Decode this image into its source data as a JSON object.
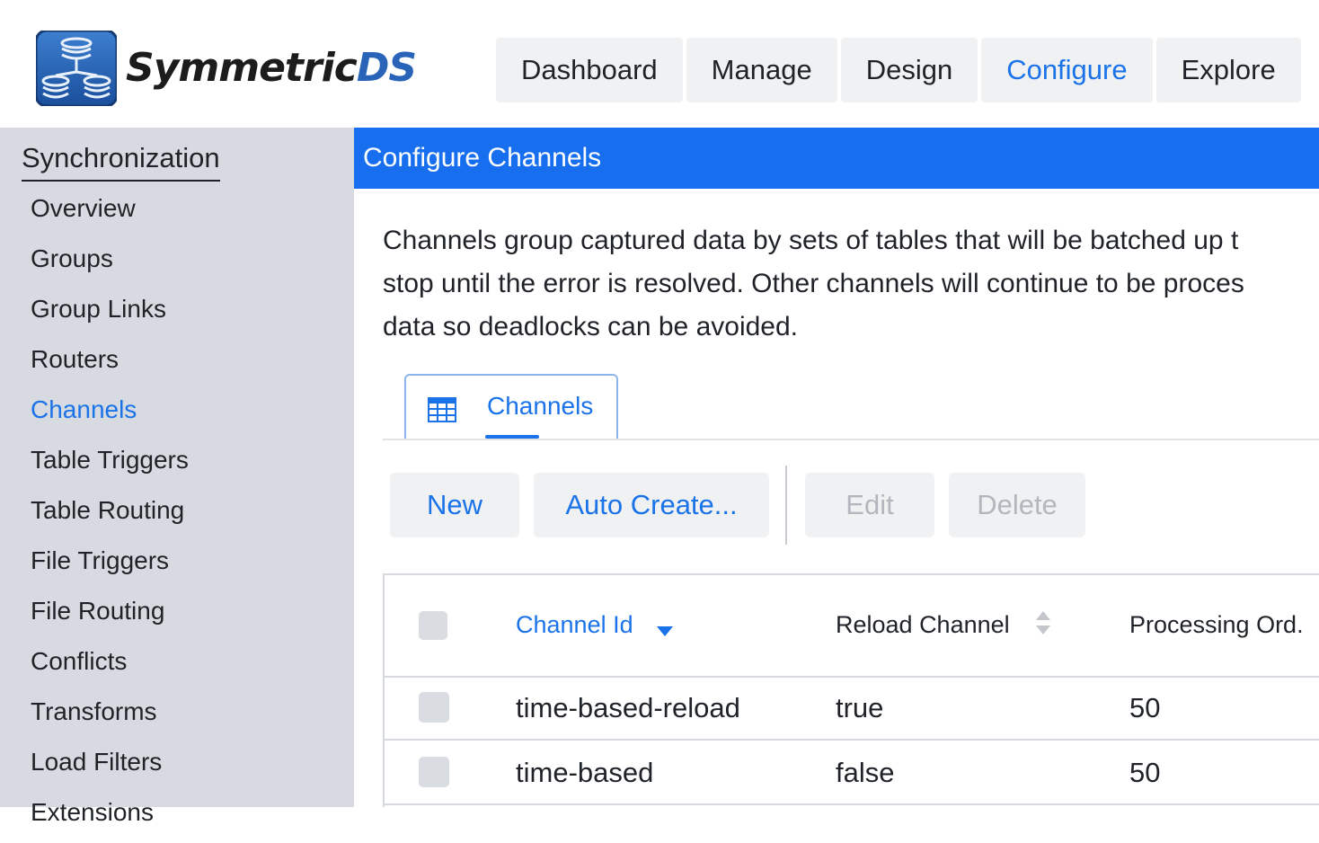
{
  "brand": {
    "name_part1": "Symmetric",
    "name_part2": "DS",
    "logo_icon": "database-stack-icon",
    "colors": {
      "dark": "#1c1c1c",
      "blue": "#2a64b8"
    }
  },
  "topnav": {
    "tabs": [
      {
        "label": "Dashboard"
      },
      {
        "label": "Manage"
      },
      {
        "label": "Design"
      },
      {
        "label": "Configure",
        "active": true
      },
      {
        "label": "Explore"
      }
    ]
  },
  "sidebar": {
    "section_title": "Synchronization",
    "items": [
      {
        "label": "Overview"
      },
      {
        "label": "Groups"
      },
      {
        "label": "Group Links"
      },
      {
        "label": "Routers"
      },
      {
        "label": "Channels",
        "active": true
      },
      {
        "label": "Table Triggers"
      },
      {
        "label": "Table Routing"
      },
      {
        "label": "File Triggers"
      },
      {
        "label": "File Routing"
      },
      {
        "label": "Conflicts"
      },
      {
        "label": "Transforms"
      },
      {
        "label": "Load Filters"
      },
      {
        "label": "Extensions"
      }
    ]
  },
  "main": {
    "title": "Configure Channels",
    "description_lines": [
      "Channels group captured data by sets of tables that will be batched up t",
      "stop until the error is resolved. Other channels will continue to be proces",
      "data so deadlocks can be avoided."
    ],
    "subtab": {
      "label": "Channels",
      "icon": "table-grid-icon"
    },
    "toolbar": {
      "new_label": "New",
      "auto_create_label": "Auto Create...",
      "edit_label": "Edit",
      "delete_label": "Delete"
    },
    "table": {
      "columns": [
        "Channel Id",
        "Reload Channel",
        "Processing Ord."
      ],
      "sorted_column": "Channel Id",
      "sort_direction": "descending",
      "rows": [
        {
          "channel_id": "time-based-reload",
          "reload_channel": "true",
          "processing_order": "50"
        },
        {
          "channel_id": "time-based",
          "reload_channel": "false",
          "processing_order": "50"
        }
      ]
    }
  },
  "colors": {
    "accent": "#1a73e8",
    "titlebar": "#176ff0",
    "sidebar_bg": "#d7dae0",
    "button_bg": "#f0f1f3",
    "disabled_text": "#b3b7bd"
  }
}
